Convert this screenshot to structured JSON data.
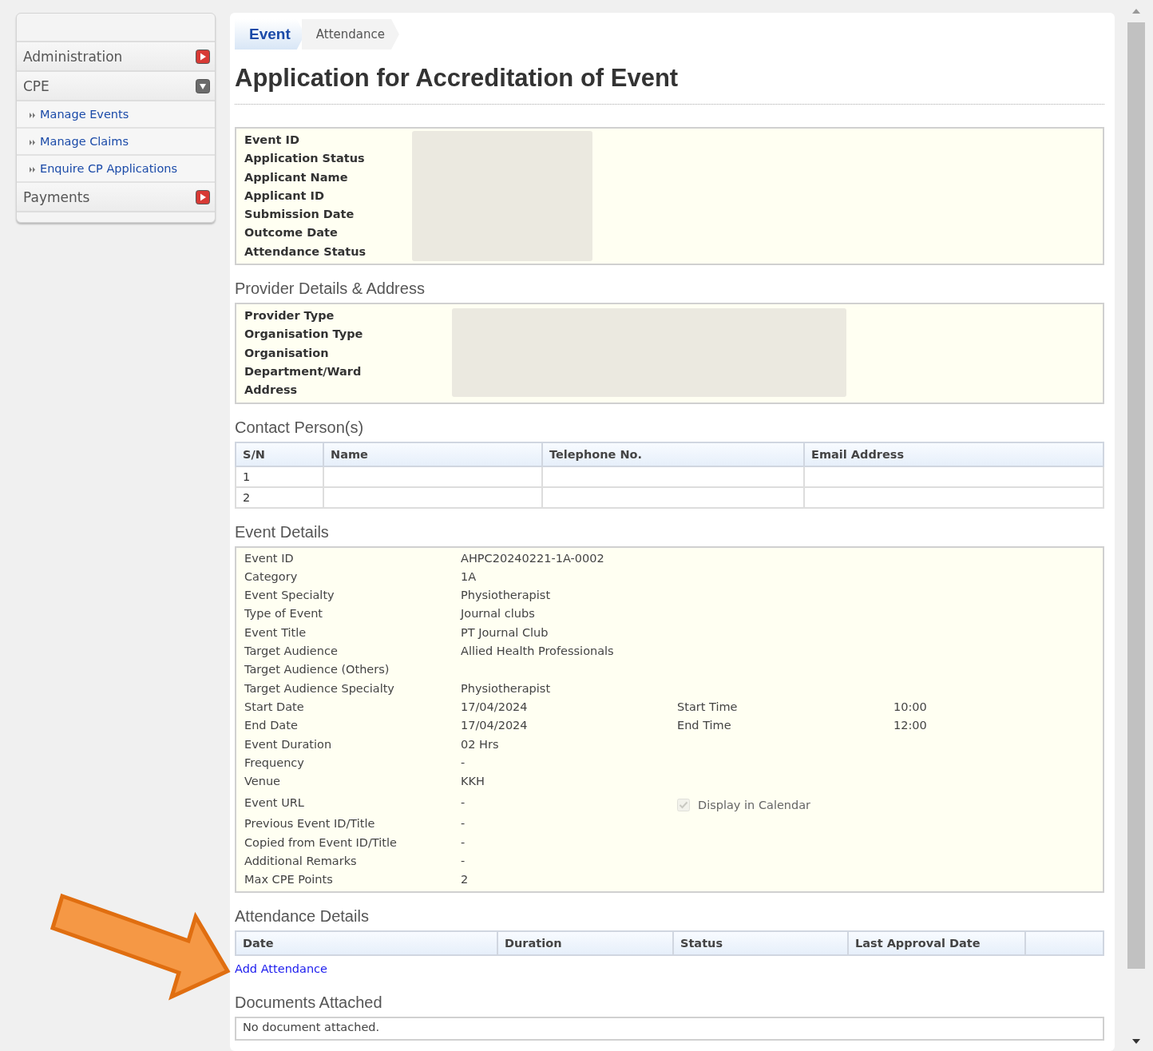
{
  "sidebar": {
    "items": [
      {
        "label": "Administration",
        "kind": "section",
        "expanded": false
      },
      {
        "label": "CPE",
        "kind": "section",
        "expanded": true
      },
      {
        "label": "Manage Events",
        "kind": "link"
      },
      {
        "label": "Manage Claims",
        "kind": "link"
      },
      {
        "label": "Enquire CP Applications",
        "kind": "link"
      },
      {
        "label": "Payments",
        "kind": "section",
        "expanded": false
      }
    ]
  },
  "breadcrumb": [
    {
      "label": "Event",
      "selected": true
    },
    {
      "label": "Attendance",
      "selected": false
    }
  ],
  "title": "Application for Accreditation of Event",
  "application_summary": {
    "labels": [
      "Event ID",
      "Application Status",
      "Applicant Name",
      "Applicant ID",
      "Submission Date",
      "Outcome Date",
      "Attendance Status"
    ]
  },
  "provider": {
    "heading": "Provider Details & Address",
    "labels": [
      "Provider Type",
      "Organisation Type",
      "Organisation",
      "Department/Ward",
      "Address"
    ]
  },
  "contacts": {
    "heading": "Contact Person(s)",
    "columns": [
      "S/N",
      "Name",
      "Telephone No.",
      "Email Address"
    ],
    "rows": [
      {
        "sn": "1"
      },
      {
        "sn": "2"
      }
    ]
  },
  "event_details": {
    "heading": "Event Details",
    "rows": [
      {
        "label": "Event ID",
        "value": "AHPC20240221-1A-0002"
      },
      {
        "label": "Category",
        "value": "1A"
      },
      {
        "label": "Event Specialty",
        "value": "Physiotherapist"
      },
      {
        "label": "Type of Event",
        "value": "Journal clubs"
      },
      {
        "label": "Event Title",
        "value": "PT Journal Club"
      },
      {
        "label": "Target Audience",
        "value": "Allied Health Professionals"
      },
      {
        "label": "Target Audience (Others)"
      },
      {
        "label": "Target Audience Specialty",
        "value": "Physiotherapist"
      },
      {
        "label": "Start Date",
        "value": "17/04/2024",
        "label_2": "Start Time",
        "value_2": "10:00"
      },
      {
        "label": "End Date",
        "value": "17/04/2024",
        "label_2": "End Time",
        "value_2": "12:00"
      },
      {
        "label": "Event Duration",
        "value": "02 Hrs"
      },
      {
        "label": "Frequency",
        "value": "-"
      },
      {
        "label": "Venue",
        "value": "KKH"
      },
      {
        "label": "Event URL",
        "value": "-",
        "checkbox": {
          "label": "Display in Calendar",
          "checked": true,
          "disabled": true
        }
      },
      {
        "label": "Previous Event ID/Title",
        "value": "-"
      },
      {
        "label": "Copied from Event ID/Title",
        "value": "-"
      },
      {
        "label": "Additional Remarks",
        "value": "-"
      },
      {
        "label": "Max CPE Points",
        "value": "2"
      }
    ]
  },
  "attendance": {
    "heading": "Attendance Details",
    "columns": [
      "Date",
      "Duration",
      "Status",
      "Last Approval Date"
    ],
    "add_link": "Add Attendance"
  },
  "documents": {
    "heading": "Documents Attached",
    "empty_text": "No document attached."
  }
}
